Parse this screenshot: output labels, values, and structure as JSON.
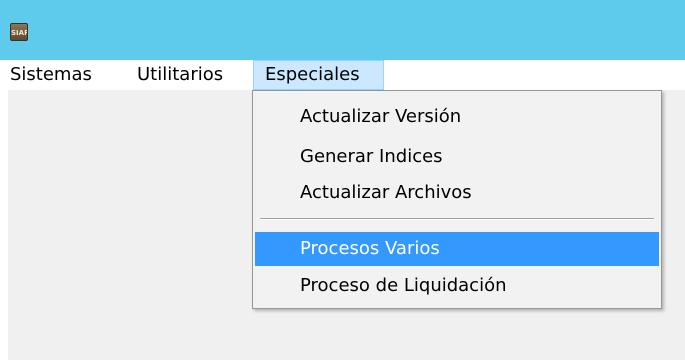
{
  "window": {
    "icon_text": "SIAF",
    "titlebar_color": "#5fcbec"
  },
  "menubar": {
    "items": [
      {
        "label": "Sistemas"
      },
      {
        "label": "Utilitarios"
      },
      {
        "label": "Especiales",
        "open": true
      }
    ]
  },
  "dropdown": {
    "items": [
      {
        "label": "Actualizar Versión"
      },
      {
        "label": "Generar Indices"
      },
      {
        "label": "Actualizar Archivos"
      },
      {
        "label": "Procesos Varios",
        "highlighted": true
      },
      {
        "label": "Proceso de Liquidación"
      }
    ],
    "highlight_color": "#3399ff"
  }
}
